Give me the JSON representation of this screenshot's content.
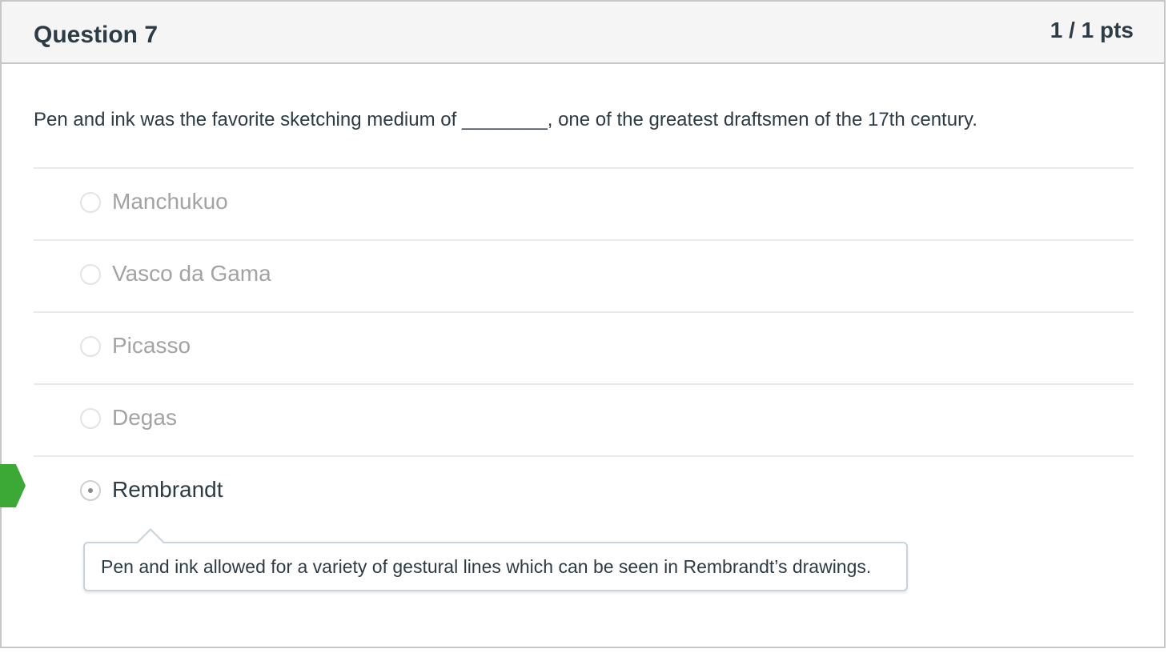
{
  "question": {
    "title": "Question 7",
    "points": "1 / 1 pts",
    "text": "Pen and ink was the favorite sketching medium of ________, one of the greatest draftsmen of the 17th century.",
    "answers": [
      {
        "label": "Manchukuo",
        "selected": false
      },
      {
        "label": "Vasco da Gama",
        "selected": false
      },
      {
        "label": "Picasso",
        "selected": false
      },
      {
        "label": "Degas",
        "selected": false
      },
      {
        "label": "Rembrandt",
        "selected": true
      }
    ],
    "correct_answer_marker": "correct-answer-flag",
    "feedback_comment": "Pen and ink allowed for a variety of gestural lines which can be seen in Rembrandt’s drawings."
  },
  "colors": {
    "correct_flag": "#3ca836",
    "text": "#2d3b45",
    "unselected_text": "#a3a3a3",
    "header_bg": "#f5f5f5"
  }
}
